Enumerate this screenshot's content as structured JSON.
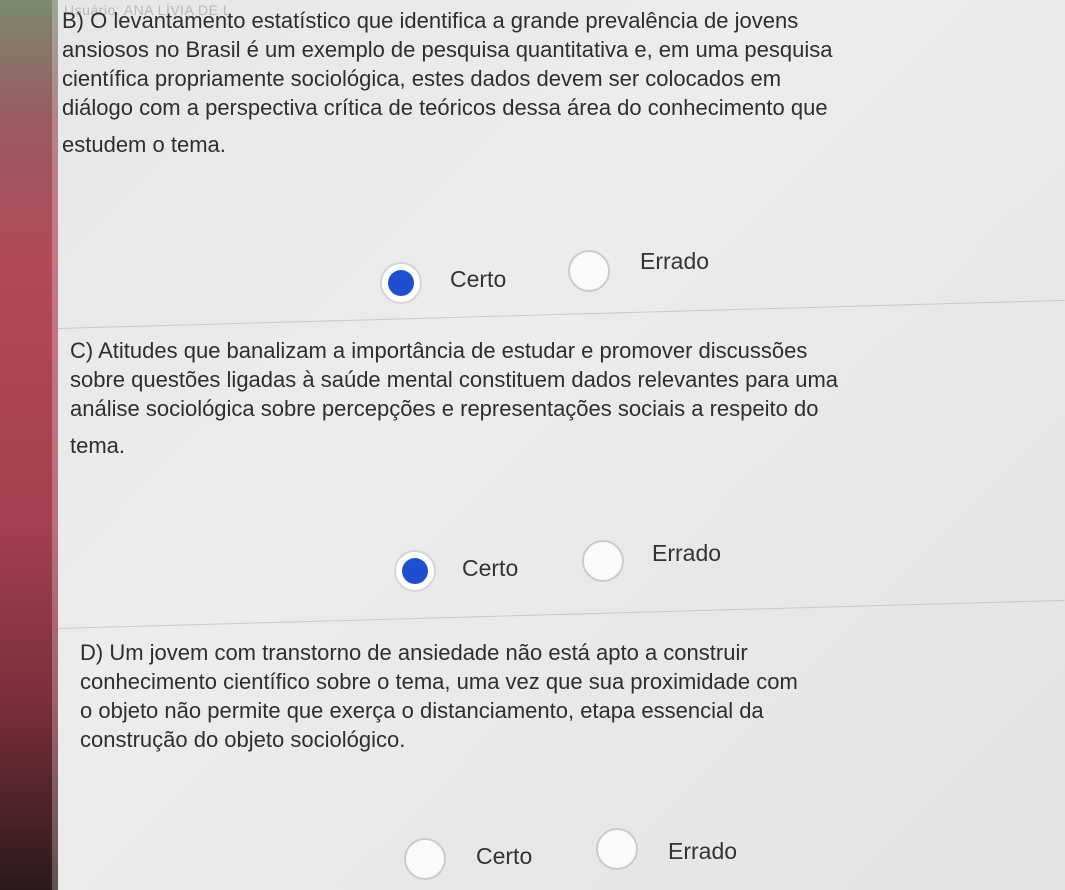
{
  "header": {
    "user_label": "Usuário: ANA LÍVIA DE L"
  },
  "questions": [
    {
      "id": "B",
      "lines": [
        "B) O levantamento estatístico que identifica a grande prevalência de jovens",
        "ansiosos no Brasil é um exemplo de pesquisa quantitativa e, em uma pesquisa",
        "científica propriamente sociológica, estes dados devem ser colocados em",
        "diálogo com a perspectiva crítica de teóricos dessa área do conhecimento que",
        "estudem o tema."
      ],
      "options": [
        {
          "label": "Certo",
          "selected": true
        },
        {
          "label": "Errado",
          "selected": false
        }
      ]
    },
    {
      "id": "C",
      "lines": [
        "C) Atitudes que banalizam a importância de estudar e promover discussões",
        "sobre questões ligadas à saúde mental constituem dados relevantes para uma",
        "análise sociológica sobre percepções e representações sociais a respeito do",
        "tema."
      ],
      "options": [
        {
          "label": "Certo",
          "selected": true
        },
        {
          "label": "Errado",
          "selected": false
        }
      ]
    },
    {
      "id": "D",
      "lines": [
        "D) Um jovem com transtorno de ansiedade não está apto a construir",
        "conhecimento científico sobre o tema, uma vez que sua proximidade com",
        "o objeto não permite que exerça o distanciamento, etapa essencial da",
        "construção do objeto sociológico."
      ],
      "options": [
        {
          "label": "Certo",
          "selected": false
        },
        {
          "label": "Errado",
          "selected": false
        }
      ]
    }
  ]
}
